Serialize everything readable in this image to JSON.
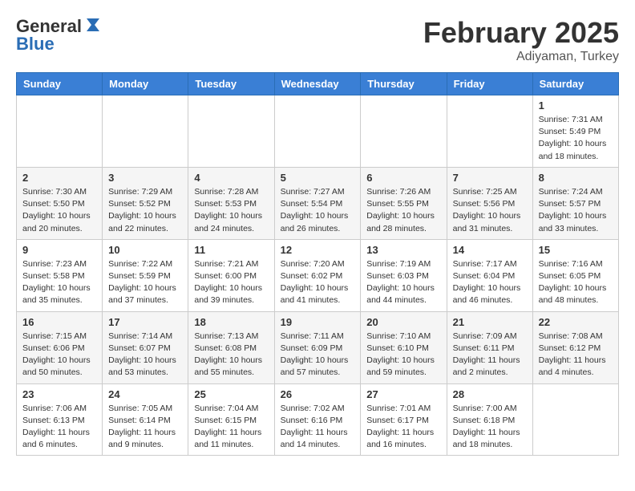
{
  "logo": {
    "general": "General",
    "blue": "Blue"
  },
  "header": {
    "month": "February 2025",
    "location": "Adiyaman, Turkey"
  },
  "weekdays": [
    "Sunday",
    "Monday",
    "Tuesday",
    "Wednesday",
    "Thursday",
    "Friday",
    "Saturday"
  ],
  "weeks": [
    [
      {
        "day": "",
        "info": ""
      },
      {
        "day": "",
        "info": ""
      },
      {
        "day": "",
        "info": ""
      },
      {
        "day": "",
        "info": ""
      },
      {
        "day": "",
        "info": ""
      },
      {
        "day": "",
        "info": ""
      },
      {
        "day": "1",
        "info": "Sunrise: 7:31 AM\nSunset: 5:49 PM\nDaylight: 10 hours\nand 18 minutes."
      }
    ],
    [
      {
        "day": "2",
        "info": "Sunrise: 7:30 AM\nSunset: 5:50 PM\nDaylight: 10 hours\nand 20 minutes."
      },
      {
        "day": "3",
        "info": "Sunrise: 7:29 AM\nSunset: 5:52 PM\nDaylight: 10 hours\nand 22 minutes."
      },
      {
        "day": "4",
        "info": "Sunrise: 7:28 AM\nSunset: 5:53 PM\nDaylight: 10 hours\nand 24 minutes."
      },
      {
        "day": "5",
        "info": "Sunrise: 7:27 AM\nSunset: 5:54 PM\nDaylight: 10 hours\nand 26 minutes."
      },
      {
        "day": "6",
        "info": "Sunrise: 7:26 AM\nSunset: 5:55 PM\nDaylight: 10 hours\nand 28 minutes."
      },
      {
        "day": "7",
        "info": "Sunrise: 7:25 AM\nSunset: 5:56 PM\nDaylight: 10 hours\nand 31 minutes."
      },
      {
        "day": "8",
        "info": "Sunrise: 7:24 AM\nSunset: 5:57 PM\nDaylight: 10 hours\nand 33 minutes."
      }
    ],
    [
      {
        "day": "9",
        "info": "Sunrise: 7:23 AM\nSunset: 5:58 PM\nDaylight: 10 hours\nand 35 minutes."
      },
      {
        "day": "10",
        "info": "Sunrise: 7:22 AM\nSunset: 5:59 PM\nDaylight: 10 hours\nand 37 minutes."
      },
      {
        "day": "11",
        "info": "Sunrise: 7:21 AM\nSunset: 6:00 PM\nDaylight: 10 hours\nand 39 minutes."
      },
      {
        "day": "12",
        "info": "Sunrise: 7:20 AM\nSunset: 6:02 PM\nDaylight: 10 hours\nand 41 minutes."
      },
      {
        "day": "13",
        "info": "Sunrise: 7:19 AM\nSunset: 6:03 PM\nDaylight: 10 hours\nand 44 minutes."
      },
      {
        "day": "14",
        "info": "Sunrise: 7:17 AM\nSunset: 6:04 PM\nDaylight: 10 hours\nand 46 minutes."
      },
      {
        "day": "15",
        "info": "Sunrise: 7:16 AM\nSunset: 6:05 PM\nDaylight: 10 hours\nand 48 minutes."
      }
    ],
    [
      {
        "day": "16",
        "info": "Sunrise: 7:15 AM\nSunset: 6:06 PM\nDaylight: 10 hours\nand 50 minutes."
      },
      {
        "day": "17",
        "info": "Sunrise: 7:14 AM\nSunset: 6:07 PM\nDaylight: 10 hours\nand 53 minutes."
      },
      {
        "day": "18",
        "info": "Sunrise: 7:13 AM\nSunset: 6:08 PM\nDaylight: 10 hours\nand 55 minutes."
      },
      {
        "day": "19",
        "info": "Sunrise: 7:11 AM\nSunset: 6:09 PM\nDaylight: 10 hours\nand 57 minutes."
      },
      {
        "day": "20",
        "info": "Sunrise: 7:10 AM\nSunset: 6:10 PM\nDaylight: 10 hours\nand 59 minutes."
      },
      {
        "day": "21",
        "info": "Sunrise: 7:09 AM\nSunset: 6:11 PM\nDaylight: 11 hours\nand 2 minutes."
      },
      {
        "day": "22",
        "info": "Sunrise: 7:08 AM\nSunset: 6:12 PM\nDaylight: 11 hours\nand 4 minutes."
      }
    ],
    [
      {
        "day": "23",
        "info": "Sunrise: 7:06 AM\nSunset: 6:13 PM\nDaylight: 11 hours\nand 6 minutes."
      },
      {
        "day": "24",
        "info": "Sunrise: 7:05 AM\nSunset: 6:14 PM\nDaylight: 11 hours\nand 9 minutes."
      },
      {
        "day": "25",
        "info": "Sunrise: 7:04 AM\nSunset: 6:15 PM\nDaylight: 11 hours\nand 11 minutes."
      },
      {
        "day": "26",
        "info": "Sunrise: 7:02 AM\nSunset: 6:16 PM\nDaylight: 11 hours\nand 14 minutes."
      },
      {
        "day": "27",
        "info": "Sunrise: 7:01 AM\nSunset: 6:17 PM\nDaylight: 11 hours\nand 16 minutes."
      },
      {
        "day": "28",
        "info": "Sunrise: 7:00 AM\nSunset: 6:18 PM\nDaylight: 11 hours\nand 18 minutes."
      },
      {
        "day": "",
        "info": ""
      }
    ]
  ]
}
